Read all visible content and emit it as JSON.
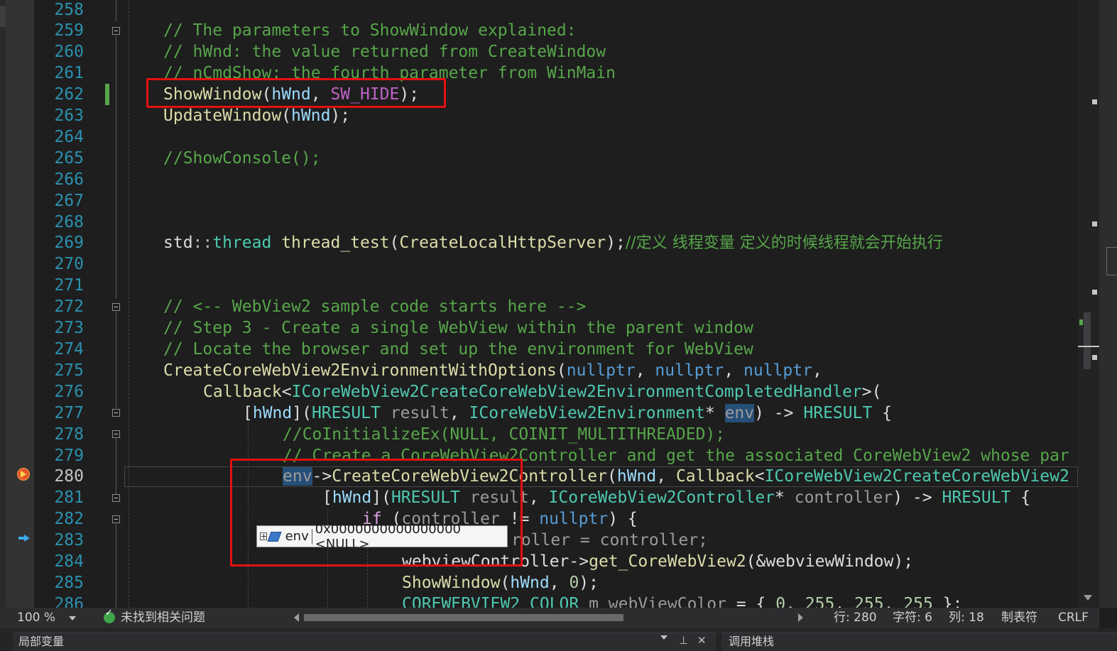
{
  "editor": {
    "lines": [
      {
        "n": "258"
      },
      {
        "n": "259"
      },
      {
        "n": "260"
      },
      {
        "n": "261"
      },
      {
        "n": "262"
      },
      {
        "n": "263"
      },
      {
        "n": "264"
      },
      {
        "n": "265"
      },
      {
        "n": "266"
      },
      {
        "n": "267"
      },
      {
        "n": "268"
      },
      {
        "n": "269"
      },
      {
        "n": "270"
      },
      {
        "n": "271"
      },
      {
        "n": "272"
      },
      {
        "n": "273"
      },
      {
        "n": "274"
      },
      {
        "n": "275"
      },
      {
        "n": "276"
      },
      {
        "n": "277"
      },
      {
        "n": "278"
      },
      {
        "n": "279"
      },
      {
        "n": "280"
      },
      {
        "n": "281"
      },
      {
        "n": "282"
      },
      {
        "n": "283"
      },
      {
        "n": "284"
      },
      {
        "n": "285"
      },
      {
        "n": "286"
      }
    ],
    "code": {
      "l259": "// The parameters to ShowWindow explained:",
      "l260": "// hWnd: the value returned from CreateWindow",
      "l261": "// nCmdShow: the fourth parameter from WinMain",
      "l262_fn": "ShowWindow",
      "l262_a": "(",
      "l262_p": "hWnd",
      "l262_b": ", ",
      "l262_m": "SW_HIDE",
      "l262_c": ");",
      "l263_fn": "UpdateWindow",
      "l263_a": "(",
      "l263_p": "hWnd",
      "l263_c": ");",
      "l265": "//ShowConsole();",
      "l269_ns": "std",
      "l269_op": "::",
      "l269_ty": "thread",
      "l269_sp": " ",
      "l269_fn": "thread_test",
      "l269_a": "(",
      "l269_arg": "CreateLocalHttpServer",
      "l269_c": ");",
      "l269_cm": "//定义 线程变量 定义的时候线程就会开始执行",
      "l272": "// <-- WebView2 sample code starts here -->",
      "l273": "// Step 3 - Create a single WebView within the parent window",
      "l274": "// Locate the browser and set up the environment for WebView",
      "l275_fn": "CreateCoreWebView2EnvironmentWithOptions",
      "l275_a": "(",
      "l275_k1": "nullptr",
      "l275_s1": ", ",
      "l275_k2": "nullptr",
      "l275_s2": ", ",
      "l275_k3": "nullptr",
      "l275_s3": ",",
      "l276_fn": "Callback",
      "l276_lt": "<",
      "l276_ty": "ICoreWebView2CreateCoreWebView2EnvironmentCompletedHandler",
      "l276_gt": ">(",
      "l277_br": "[",
      "l277_p": "hWnd",
      "l277_a": "](",
      "l277_ty1": "HRESULT",
      "l277_v1": " result",
      "l277_s": ", ",
      "l277_ty2": "ICoreWebView2Environment",
      "l277_st": "* ",
      "l277_env": "env",
      "l277_arr": ") -> ",
      "l277_ty3": "HRESULT",
      "l277_brace": " {",
      "l278": "//CoInitializeEx(NULL, COINIT_MULTITHREADED);",
      "l279": "// Create a CoreWebView2Controller and get the associated CoreWebView2 whose par",
      "l280_env": "env",
      "l280_arr": "->",
      "l280_fn": "CreateCoreWebView2Controller",
      "l280_a": "(",
      "l280_p": "hWnd",
      "l280_s": ", ",
      "l280_fn2": "Callback",
      "l280_lt": "<",
      "l280_ty": "ICoreWebView2CreateCoreWebView2",
      "l281_br": "[",
      "l281_p": "hWnd",
      "l281_a": "](",
      "l281_ty1": "HRESULT",
      "l281_v1": " result",
      "l281_s": ", ",
      "l281_ty2": "ICoreWebView2Controller",
      "l281_st": "* ",
      "l281_v2": "controller",
      "l281_arr": ") -> ",
      "l281_ty3": "HRESULT",
      "l281_brace": " {",
      "l282_kw": "if",
      "l282_sp": " (",
      "l282_v": "controller",
      "l282_ne": " != ",
      "l282_k": "nullptr",
      "l282_end": ") {",
      "l283_rest": "roller = controller;",
      "l284_a": "webviewController",
      "l284_arr": "->",
      "l284_fn": "get_CoreWebView2",
      "l284_b": "(&webviewWindow);",
      "l285_fn": "ShowWindow",
      "l285_a": "(",
      "l285_p": "hWnd",
      "l285_b": ", ",
      "l285_n": "0",
      "l285_c": ");",
      "l286_ty": "COREWEBVIEW2_COLOR",
      "l286_v": " m_webViewColor",
      "l286_eq": " = { ",
      "l286_n1": "0",
      "l286_s1": ", ",
      "l286_n2": "255",
      "l286_s2": ", ",
      "l286_n3": "255",
      "l286_s3": ", ",
      "l286_n4": "255",
      "l286_end": " };"
    },
    "datatip": {
      "name": "env",
      "value": "0x0000000000000000 <NULL>"
    }
  },
  "statusbar": {
    "zoom": "100 %",
    "issues": "未找到相关问题",
    "row": "行: 280",
    "char": "字符: 6",
    "col": "列: 18",
    "indent": "制表符",
    "eol": "CRLF"
  },
  "bottom_panels": {
    "left_title": "局部变量",
    "right_title": "调用堆栈",
    "pin": "⊥",
    "close": "✕"
  },
  "colors": {
    "background": "#1e1e1e",
    "highlight_box": "#e51010",
    "line_number": "#2b91af",
    "comment": "#57a64a"
  }
}
